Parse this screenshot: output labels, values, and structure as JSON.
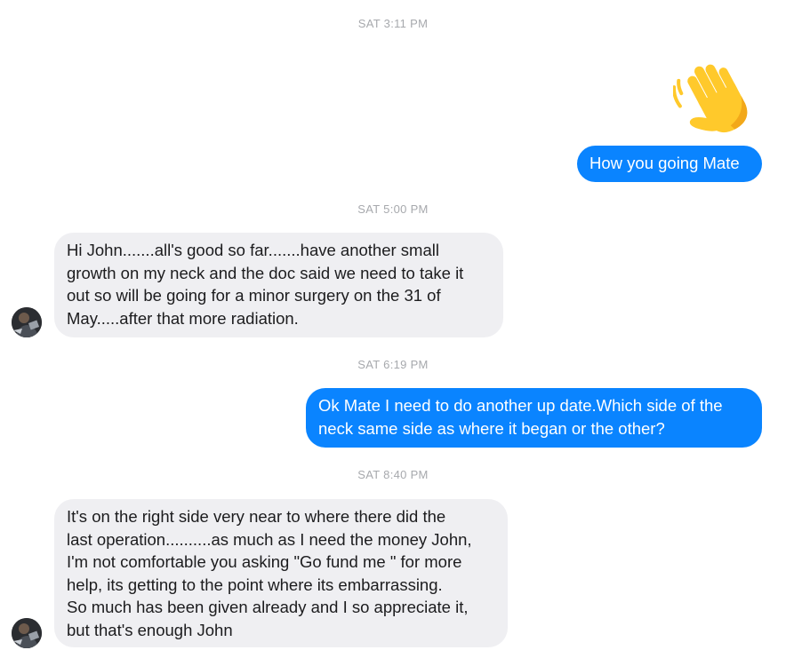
{
  "conversation": {
    "timestamps": [
      "SAT 3:11 PM",
      "SAT 5:00 PM",
      "SAT 6:19 PM",
      "SAT 8:40 PM"
    ],
    "messages": [
      {
        "direction": "outgoing",
        "type": "emoji",
        "emoji_icon": "waving-hand-icon"
      },
      {
        "direction": "outgoing",
        "lines": [
          "How you going Mate"
        ]
      },
      {
        "direction": "incoming",
        "lines": [
          "Hi John.......all's good so far.......have another small",
          "growth on my neck and the doc said we need to take it",
          "out so will be going for a minor surgery on the 31 of",
          "May.....after that more radiation."
        ]
      },
      {
        "direction": "outgoing",
        "lines": [
          "Ok Mate I need to do another up date.Which side of the",
          "neck same side as where it began or the other?"
        ]
      },
      {
        "direction": "incoming",
        "lines": [
          "It's on the right side very near to where there did the",
          "last operation..........as much as I need the money John,",
          "I'm not comfortable you asking \"Go fund me \" for more",
          "help, its getting to the point where its embarrassing.",
          "So much has been given already and I so appreciate it,",
          "but that's enough John"
        ]
      }
    ]
  },
  "colors": {
    "outgoing_bubble": "#0a84ff",
    "incoming_bubble": "#efeff2",
    "timestamp_text": "#a7a9ad",
    "emoji_yellow": "#ffc92b"
  }
}
